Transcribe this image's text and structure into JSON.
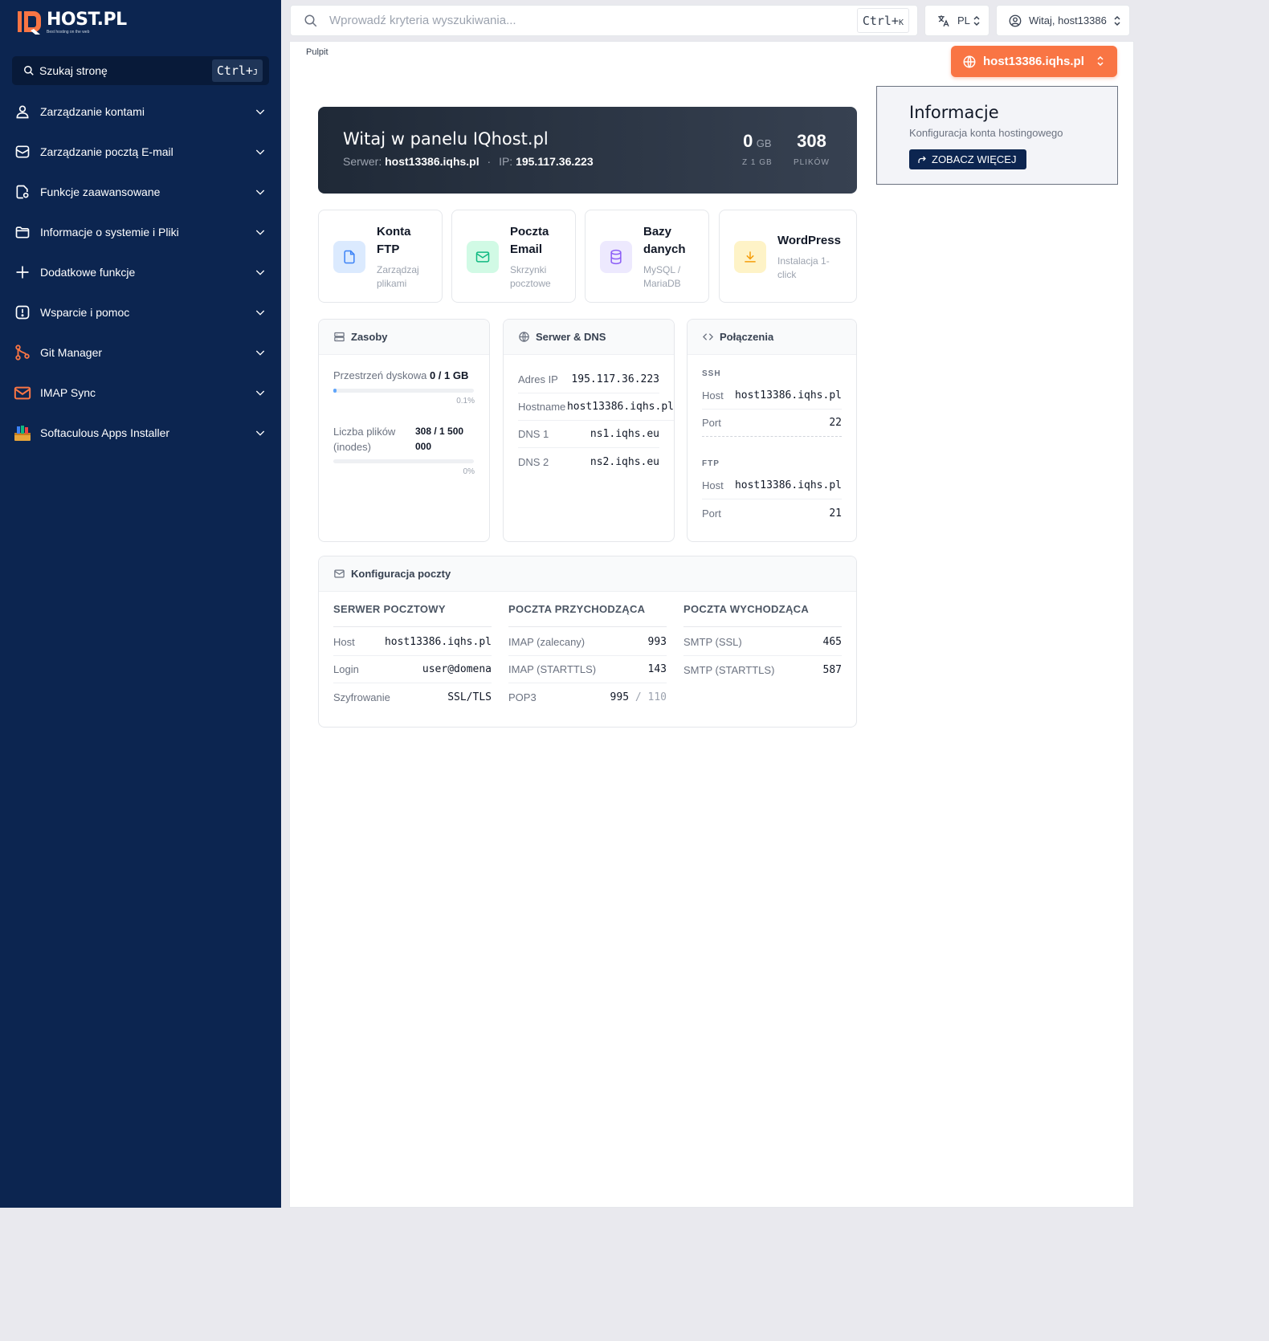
{
  "colors": {
    "sidebar": "#0c2550",
    "accent": "#f97544",
    "welcome_bg": "#1f2937"
  },
  "logo": {
    "text": "HOST.PL",
    "tagline": "Best hosting on the web"
  },
  "sidebar": {
    "search": {
      "label": "Szukaj stronę",
      "kbd": "Ctrl+",
      "kbd_key": "J"
    },
    "items": [
      {
        "label": "Zarządzanie kontami",
        "icon": "user-icon"
      },
      {
        "label": "Zarządzanie pocztą E-mail",
        "icon": "mail-icon"
      },
      {
        "label": "Funkcje zaawansowane",
        "icon": "file-gear-icon"
      },
      {
        "label": "Informacje o systemie i Pliki",
        "icon": "folder-icon"
      },
      {
        "label": "Dodatkowe funkcje",
        "icon": "plus-icon"
      },
      {
        "label": "Wsparcie i pomoc",
        "icon": "alert-icon"
      },
      {
        "label": "Git Manager",
        "icon": "git-icon"
      },
      {
        "label": "IMAP Sync",
        "icon": "imap-mail-icon"
      },
      {
        "label": "Softaculous Apps Installer",
        "icon": "softaculous-icon"
      }
    ]
  },
  "topbar": {
    "search_placeholder": "Wprowadź kryteria wyszukiwania...",
    "kbd": "Ctrl+",
    "kbd_key": "K",
    "lang": "PL",
    "user": "Witaj, host13386"
  },
  "breadcrumb": "Pulpit",
  "host_button": "host13386.iqhs.pl",
  "welcome": {
    "title": "Witaj w panelu IQhost.pl",
    "server_label": "Serwer:",
    "server": "host13386.iqhs.pl",
    "sep": "·",
    "ip_label": "IP:",
    "ip": "195.117.36.223",
    "disk_value": "0",
    "disk_unit": "GB",
    "disk_label": "Z 1 GB",
    "files_value": "308",
    "files_label": "PLIKÓW"
  },
  "info": {
    "title": "Informacje",
    "subtitle": "Konfiguracja konta hostingowego",
    "button": "ZOBACZ WIĘCEJ"
  },
  "quick": [
    {
      "title1": "Konta",
      "title2": "FTP",
      "sub1": "Zarządzaj",
      "sub2": "plikami",
      "icon": "file-icon",
      "bg": "#dbeafe",
      "color": "#3b82f6"
    },
    {
      "title1": "Poczta",
      "title2": "Email",
      "sub1": "Skrzynki",
      "sub2": "pocztowe",
      "icon": "mail-icon",
      "bg": "#d1fae5",
      "color": "#10b981"
    },
    {
      "title1": "Bazy",
      "title2": "danych",
      "sub1": "MySQL /",
      "sub2": "MariaDB",
      "icon": "database-icon",
      "bg": "#ede9fe",
      "color": "#8b5cf6"
    },
    {
      "title1": "WordPress",
      "sub1": "Instalacja 1-",
      "sub2": "click",
      "icon": "download-icon",
      "bg": "#fef3c7",
      "color": "#f59e0b"
    }
  ],
  "resources": {
    "title": "Zasoby",
    "disk_label": "Przestrzeń dyskowa",
    "disk_value": "0 / 1 GB",
    "disk_pct": "0.1%",
    "disk_fraction": 0.02,
    "files_label1": "Liczba plików",
    "files_label2": "(inodes)",
    "files_value1": "308 / 1 500",
    "files_value2": "000",
    "files_pct": "0%",
    "files_fraction": 0
  },
  "dns": {
    "title": "Serwer & DNS",
    "rows": [
      {
        "label": "Adres IP",
        "value": "195.117.36.223"
      },
      {
        "label": "Hostname",
        "value": "host13386.iqhs.pl"
      },
      {
        "label": "DNS 1",
        "value": "ns1.iqhs.eu"
      },
      {
        "label": "DNS 2",
        "value": "ns2.iqhs.eu"
      }
    ]
  },
  "connections": {
    "title": "Połączenia",
    "ssh_label": "SSH",
    "ssh_host_label": "Host",
    "ssh_host": "host13386.iqhs.pl",
    "ssh_port_label": "Port",
    "ssh_port": "22",
    "ftp_label": "FTP",
    "ftp_host_label": "Host",
    "ftp_host": "host13386.iqhs.pl",
    "ftp_port_label": "Port",
    "ftp_port": "21"
  },
  "mail": {
    "title": "Konfiguracja poczty",
    "col1": {
      "header": "SERWER POCZTOWY",
      "rows": [
        {
          "label": "Host",
          "value": "host13386.iqhs.pl"
        },
        {
          "label": "Login",
          "value": "user@domena"
        },
        {
          "label": "Szyfrowanie",
          "value": "SSL/TLS"
        }
      ]
    },
    "col2": {
      "header": "POCZTA PRZYCHODZĄCA",
      "rows": [
        {
          "label": "IMAP (zalecany)",
          "value": "993"
        },
        {
          "label": "IMAP (STARTTLS)",
          "value": "143"
        },
        {
          "label": "POP3",
          "value": "995",
          "extra": "/ 110"
        }
      ]
    },
    "col3": {
      "header": "POCZTA WYCHODZĄCA",
      "rows": [
        {
          "label": "SMTP (SSL)",
          "value": "465"
        },
        {
          "label": "SMTP (STARTTLS)",
          "value": "587"
        }
      ]
    }
  }
}
